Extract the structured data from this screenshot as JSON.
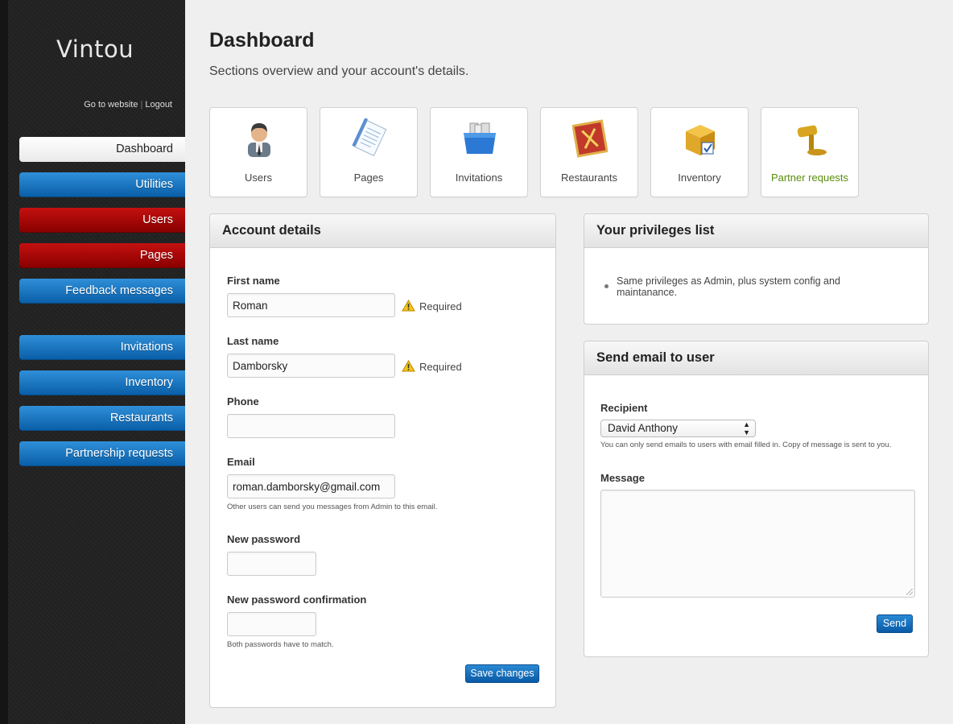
{
  "app": {
    "logo": "Vintou"
  },
  "toplinks": {
    "website": "Go to website",
    "logout": "Logout"
  },
  "nav": [
    {
      "label": "Dashboard",
      "style": "white"
    },
    {
      "label": "Utilities",
      "style": "blue"
    },
    {
      "label": "Users",
      "style": "red"
    },
    {
      "label": "Pages",
      "style": "red"
    },
    {
      "label": "Feedback messages",
      "style": "blue"
    },
    {
      "label": "Invitations",
      "style": "blue"
    },
    {
      "label": "Inventory",
      "style": "blue"
    },
    {
      "label": "Restaurants",
      "style": "blue"
    },
    {
      "label": "Partnership requests",
      "style": "blue"
    }
  ],
  "page": {
    "title": "Dashboard",
    "subtitle": "Sections overview and your account's details."
  },
  "tiles": [
    {
      "label": "Users",
      "icon": "user-icon"
    },
    {
      "label": "Pages",
      "icon": "pages-icon"
    },
    {
      "label": "Invitations",
      "icon": "invitations-folder-icon"
    },
    {
      "label": "Restaurants",
      "icon": "restaurant-icon"
    },
    {
      "label": "Inventory",
      "icon": "inventory-box-icon"
    },
    {
      "label": "Partner requests",
      "icon": "gavel-icon"
    }
  ],
  "account": {
    "title": "Account details",
    "first_name": {
      "label": "First name",
      "value": "Roman",
      "required": "Required"
    },
    "last_name": {
      "label": "Last name",
      "value": "Damborsky",
      "required": "Required"
    },
    "phone": {
      "label": "Phone",
      "value": ""
    },
    "email": {
      "label": "Email",
      "value": "roman.damborsky@gmail.com",
      "hint": "Other users can send you messages from Admin to this email."
    },
    "new_password": {
      "label": "New password",
      "value": ""
    },
    "new_password_confirmation": {
      "label": "New password confirmation",
      "value": "",
      "hint": "Both passwords have to match."
    },
    "save_label": "Save changes"
  },
  "privileges": {
    "title": "Your privileges list",
    "items": [
      "Same privileges as Admin, plus system config and maintanance."
    ]
  },
  "send_email": {
    "title": "Send email to user",
    "recipient_label": "Recipient",
    "recipient_value": "David Anthony",
    "recipient_hint": "You can only send emails to users with email filled in. Copy of message is sent to you.",
    "message_label": "Message",
    "message_value": "",
    "send_label": "Send"
  },
  "colors": {
    "nav_blue": "#0a5fa8",
    "nav_red": "#a30000",
    "active_tile_text": "#5a8d0c",
    "button_blue": "#0a5aa6"
  }
}
